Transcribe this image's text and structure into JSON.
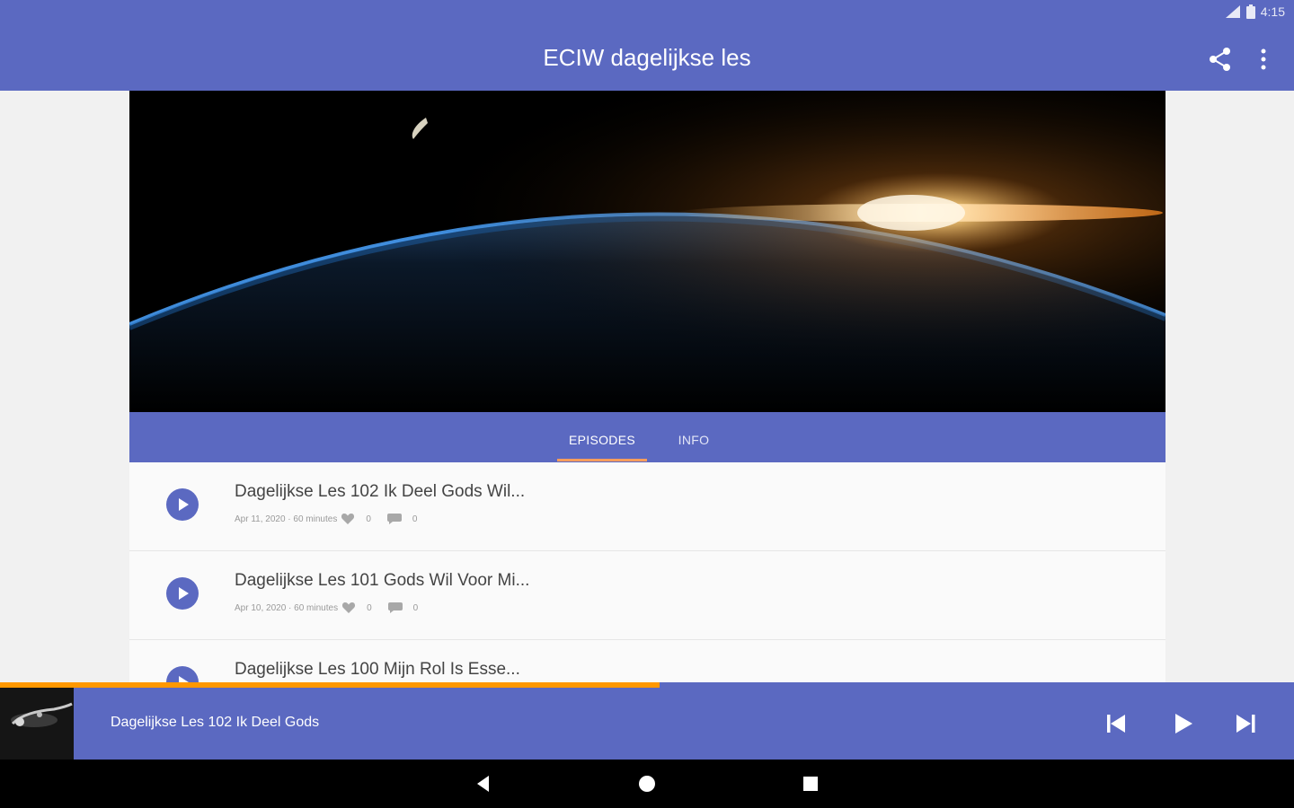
{
  "status_bar": {
    "network": "4G",
    "time": "4:15"
  },
  "app_bar": {
    "title": "ECIW dagelijkse les",
    "share_icon": "share-icon",
    "more_icon": "more-vert-icon"
  },
  "tabs": [
    {
      "label": "EPISODES",
      "selected": true
    },
    {
      "label": "INFO",
      "selected": false
    }
  ],
  "episodes": [
    {
      "title": "Dagelijkse Les 102 Ik Deel Gods Wil...",
      "meta": "Apr 11, 2020 · 60 minutes",
      "likes": "0",
      "comments": "0"
    },
    {
      "title": "Dagelijkse Les 101 Gods Wil Voor Mi...",
      "meta": "Apr 10, 2020 · 60 minutes",
      "likes": "0",
      "comments": "0"
    },
    {
      "title": "Dagelijkse Les 100 Mijn Rol Is Esse...",
      "meta": "",
      "likes": "",
      "comments": ""
    }
  ],
  "player": {
    "title": "Dagelijkse Les 102 Ik Deel Gods",
    "progress": 0.51
  },
  "colors": {
    "primary": "#5b69c1",
    "accent": "#ff9800",
    "tab_indicator": "#ff9d5c"
  }
}
